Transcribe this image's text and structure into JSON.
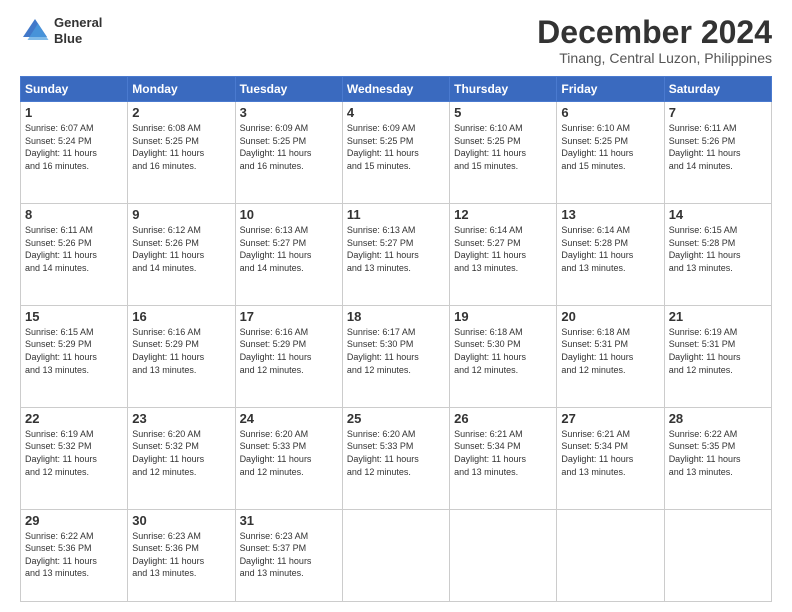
{
  "header": {
    "logo_line1": "General",
    "logo_line2": "Blue",
    "month": "December 2024",
    "location": "Tinang, Central Luzon, Philippines"
  },
  "weekdays": [
    "Sunday",
    "Monday",
    "Tuesday",
    "Wednesday",
    "Thursday",
    "Friday",
    "Saturday"
  ],
  "weeks": [
    [
      {
        "day": "1",
        "info": "Sunrise: 6:07 AM\nSunset: 5:24 PM\nDaylight: 11 hours\nand 16 minutes."
      },
      {
        "day": "2",
        "info": "Sunrise: 6:08 AM\nSunset: 5:25 PM\nDaylight: 11 hours\nand 16 minutes."
      },
      {
        "day": "3",
        "info": "Sunrise: 6:09 AM\nSunset: 5:25 PM\nDaylight: 11 hours\nand 16 minutes."
      },
      {
        "day": "4",
        "info": "Sunrise: 6:09 AM\nSunset: 5:25 PM\nDaylight: 11 hours\nand 15 minutes."
      },
      {
        "day": "5",
        "info": "Sunrise: 6:10 AM\nSunset: 5:25 PM\nDaylight: 11 hours\nand 15 minutes."
      },
      {
        "day": "6",
        "info": "Sunrise: 6:10 AM\nSunset: 5:25 PM\nDaylight: 11 hours\nand 15 minutes."
      },
      {
        "day": "7",
        "info": "Sunrise: 6:11 AM\nSunset: 5:26 PM\nDaylight: 11 hours\nand 14 minutes."
      }
    ],
    [
      {
        "day": "8",
        "info": "Sunrise: 6:11 AM\nSunset: 5:26 PM\nDaylight: 11 hours\nand 14 minutes."
      },
      {
        "day": "9",
        "info": "Sunrise: 6:12 AM\nSunset: 5:26 PM\nDaylight: 11 hours\nand 14 minutes."
      },
      {
        "day": "10",
        "info": "Sunrise: 6:13 AM\nSunset: 5:27 PM\nDaylight: 11 hours\nand 14 minutes."
      },
      {
        "day": "11",
        "info": "Sunrise: 6:13 AM\nSunset: 5:27 PM\nDaylight: 11 hours\nand 13 minutes."
      },
      {
        "day": "12",
        "info": "Sunrise: 6:14 AM\nSunset: 5:27 PM\nDaylight: 11 hours\nand 13 minutes."
      },
      {
        "day": "13",
        "info": "Sunrise: 6:14 AM\nSunset: 5:28 PM\nDaylight: 11 hours\nand 13 minutes."
      },
      {
        "day": "14",
        "info": "Sunrise: 6:15 AM\nSunset: 5:28 PM\nDaylight: 11 hours\nand 13 minutes."
      }
    ],
    [
      {
        "day": "15",
        "info": "Sunrise: 6:15 AM\nSunset: 5:29 PM\nDaylight: 11 hours\nand 13 minutes."
      },
      {
        "day": "16",
        "info": "Sunrise: 6:16 AM\nSunset: 5:29 PM\nDaylight: 11 hours\nand 13 minutes."
      },
      {
        "day": "17",
        "info": "Sunrise: 6:16 AM\nSunset: 5:29 PM\nDaylight: 11 hours\nand 12 minutes."
      },
      {
        "day": "18",
        "info": "Sunrise: 6:17 AM\nSunset: 5:30 PM\nDaylight: 11 hours\nand 12 minutes."
      },
      {
        "day": "19",
        "info": "Sunrise: 6:18 AM\nSunset: 5:30 PM\nDaylight: 11 hours\nand 12 minutes."
      },
      {
        "day": "20",
        "info": "Sunrise: 6:18 AM\nSunset: 5:31 PM\nDaylight: 11 hours\nand 12 minutes."
      },
      {
        "day": "21",
        "info": "Sunrise: 6:19 AM\nSunset: 5:31 PM\nDaylight: 11 hours\nand 12 minutes."
      }
    ],
    [
      {
        "day": "22",
        "info": "Sunrise: 6:19 AM\nSunset: 5:32 PM\nDaylight: 11 hours\nand 12 minutes."
      },
      {
        "day": "23",
        "info": "Sunrise: 6:20 AM\nSunset: 5:32 PM\nDaylight: 11 hours\nand 12 minutes."
      },
      {
        "day": "24",
        "info": "Sunrise: 6:20 AM\nSunset: 5:33 PM\nDaylight: 11 hours\nand 12 minutes."
      },
      {
        "day": "25",
        "info": "Sunrise: 6:20 AM\nSunset: 5:33 PM\nDaylight: 11 hours\nand 12 minutes."
      },
      {
        "day": "26",
        "info": "Sunrise: 6:21 AM\nSunset: 5:34 PM\nDaylight: 11 hours\nand 13 minutes."
      },
      {
        "day": "27",
        "info": "Sunrise: 6:21 AM\nSunset: 5:34 PM\nDaylight: 11 hours\nand 13 minutes."
      },
      {
        "day": "28",
        "info": "Sunrise: 6:22 AM\nSunset: 5:35 PM\nDaylight: 11 hours\nand 13 minutes."
      }
    ],
    [
      {
        "day": "29",
        "info": "Sunrise: 6:22 AM\nSunset: 5:36 PM\nDaylight: 11 hours\nand 13 minutes."
      },
      {
        "day": "30",
        "info": "Sunrise: 6:23 AM\nSunset: 5:36 PM\nDaylight: 11 hours\nand 13 minutes."
      },
      {
        "day": "31",
        "info": "Sunrise: 6:23 AM\nSunset: 5:37 PM\nDaylight: 11 hours\nand 13 minutes."
      },
      null,
      null,
      null,
      null
    ]
  ]
}
